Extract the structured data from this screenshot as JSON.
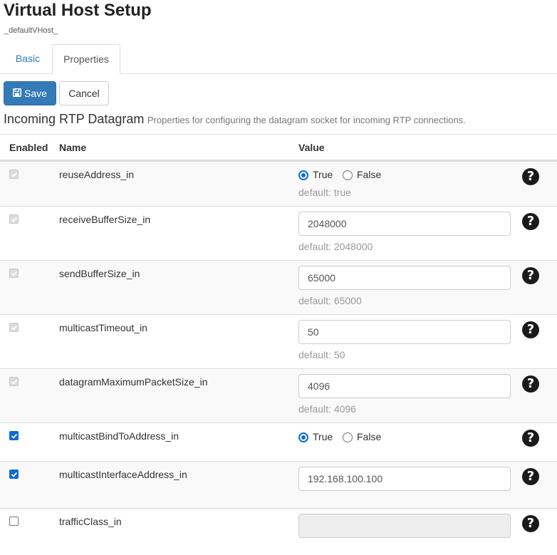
{
  "page": {
    "title": "Virtual Host Setup",
    "subtitle": "_defaultVHost_"
  },
  "tabs": [
    {
      "label": "Basic",
      "active": false
    },
    {
      "label": "Properties",
      "active": true
    }
  ],
  "toolbar": {
    "save_label": "Save",
    "save_icon": "floppy-disk-icon",
    "cancel_label": "Cancel"
  },
  "section": {
    "title": "Incoming RTP Datagram",
    "description": "Properties for configuring the datagram socket for incoming RTP connections."
  },
  "table": {
    "headers": {
      "enabled": "Enabled",
      "name": "Name",
      "value": "Value"
    },
    "rows": [
      {
        "name": "reuseAddress_in",
        "enabled": "disabled-checked",
        "type": "radio",
        "value": "True",
        "options": [
          "True",
          "False"
        ],
        "default": "default: true"
      },
      {
        "name": "receiveBufferSize_in",
        "enabled": "disabled-checked",
        "type": "text",
        "value": "2048000",
        "default": "default: 2048000"
      },
      {
        "name": "sendBufferSize_in",
        "enabled": "disabled-checked",
        "type": "text",
        "value": "65000",
        "default": "default: 65000"
      },
      {
        "name": "multicastTimeout_in",
        "enabled": "disabled-checked",
        "type": "text",
        "value": "50",
        "default": "default: 50"
      },
      {
        "name": "datagramMaximumPacketSize_in",
        "enabled": "disabled-checked",
        "type": "text",
        "value": "4096",
        "default": "default: 4096"
      },
      {
        "name": "multicastBindToAddress_in",
        "enabled": "checked",
        "type": "radio",
        "value": "True",
        "options": [
          "True",
          "False"
        ],
        "default": ""
      },
      {
        "name": "multicastInterfaceAddress_in",
        "enabled": "checked",
        "type": "text",
        "value": "192.168.100.100",
        "default": ""
      },
      {
        "name": "trafficClass_in",
        "enabled": "unchecked",
        "type": "text-disabled",
        "value": "",
        "default": ""
      }
    ]
  },
  "help_icon": "question-circle-icon",
  "colors": {
    "primary": "#337ab7",
    "checkbox_accent": "#0b6bd6",
    "muted_text": "#999999"
  }
}
